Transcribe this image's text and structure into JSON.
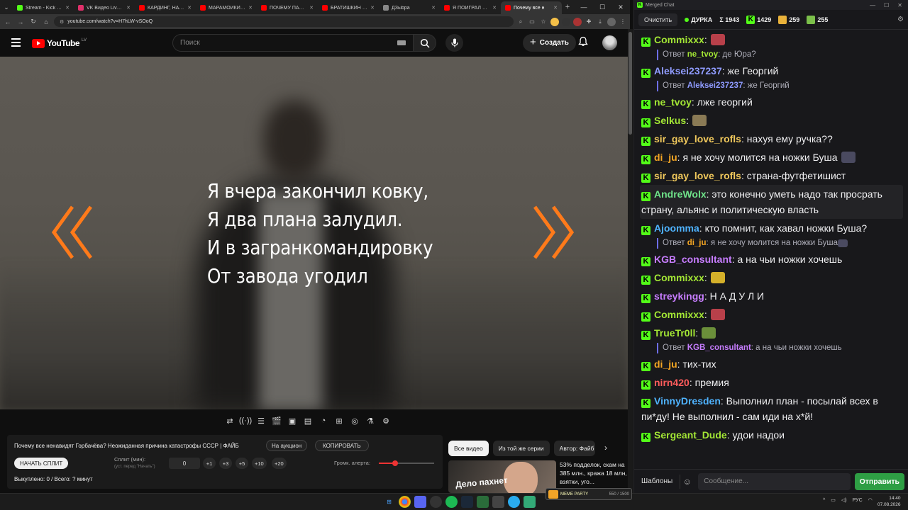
{
  "browser": {
    "tabs": [
      {
        "title": "Stream - Kick Dashbo",
        "color": "#53fc18",
        "active": false
      },
      {
        "title": "VK Видео Live — Гла",
        "color": "#e0306a",
        "active": false
      },
      {
        "title": "КАРДИНГ, НАКРУТ...",
        "color": "#ff0000",
        "active": false
      },
      {
        "title": "МАРАМОЙКИ УЧАТ",
        "color": "#ff0000",
        "active": false
      },
      {
        "title": "ПОЧЕМУ ПАПА ПР",
        "color": "#ff0000",
        "active": false
      },
      {
        "title": "БРАТИШКИН СОЦ",
        "color": "#ff0000",
        "active": false
      },
      {
        "title": "ДЗыbра",
        "color": "#888888",
        "active": false
      },
      {
        "title": "Я ПОИГРАЛ В WA...",
        "color": "#ff0000",
        "active": false
      },
      {
        "title": "Почему все н",
        "color": "#ff0000",
        "active": true
      }
    ],
    "url": "youtube.com/watch?v=H7hLW-vSOoQ",
    "newtab": "+",
    "win_min": "—",
    "win_max": "☐",
    "win_close": "✕"
  },
  "youtube": {
    "logo_text": "YouTube",
    "region": "LV",
    "search_placeholder": "Поиск",
    "create_label": "Создать",
    "create_plus": "+",
    "lyrics": [
      "Я вчера закончил ковку,",
      "Я два плана залудил.",
      "И в загранкомандировку",
      "От завода угодил"
    ],
    "accent_orange": "#ff7a1a"
  },
  "plugin_panel": {
    "video_title": "Почему все ненавидят Горбачёва? Неожиданная причина катастрофы СССР | ФАЙБ",
    "auction_btn": "На аукцион",
    "copy_btn": "КОПИРОВАТЬ",
    "start_split_btn": "НАЧАТЬ СПЛИТ",
    "split_label": "Сплит (мин):",
    "split_hint": "(уст. перед \"Начать\")",
    "split_value": "0",
    "steps": [
      "+1",
      "+3",
      "+5",
      "+10",
      "+20"
    ],
    "alert_volume_label": "Громк. алерта:",
    "alert_volume": 0.3,
    "bought_status": "Выкуплено: 0 / Всего: ? минут"
  },
  "recommendations": {
    "tabs": [
      "Все видео",
      "Из той же серии",
      "Автор: Файб"
    ],
    "first_title": "53% подделок, скам на 385 млн., кража 18 млн, взятки, уго...",
    "thumb_text": "Дело пахнет"
  },
  "chat": {
    "window_title": "Merged Chat",
    "clear_btn": "Очистить",
    "channel": "ДУРКА",
    "sum": "Σ 1943",
    "kick_count": "1429",
    "viewers2": "259",
    "viewers3": "255",
    "messages": [
      {
        "user": "Commixxx",
        "color": "#a3e635",
        "text": "",
        "emote": "#b8404a"
      },
      {
        "reply_user": "ne_tvoy",
        "reply_color": "#a3e635",
        "reply_text": ": де Юра?"
      },
      {
        "user": "Aleksei237237",
        "color": "#8f9bff",
        "text": " же Георгий"
      },
      {
        "reply_user": "Aleksei237237",
        "reply_color": "#8f9bff",
        "reply_text": ": же Георгий"
      },
      {
        "user": "ne_tvoy",
        "color": "#a3e635",
        "text": " лже георгий"
      },
      {
        "user": "Selkus",
        "color": "#a3e635",
        "text": "",
        "emote": "#8a7a55"
      },
      {
        "user": "sir_gay_love_rofls",
        "color": "#f0c85c",
        "text": " нахуя ему ручка??"
      },
      {
        "user": "di_ju",
        "color": "#f5a623",
        "text": " я не хочу молится на ножки Буша",
        "emote": "#4a4a60"
      },
      {
        "user": "sir_gay_love_rofls",
        "color": "#f0c85c",
        "text": " страна-футфетишист"
      },
      {
        "user": "AndreWolx",
        "color": "#6fe38a",
        "text": " это конечно уметь надо так просрать страну, альянс и политическую власть",
        "hl": true
      },
      {
        "user": "Ajoomma",
        "color": "#4fb3ff",
        "text": " кто помнит, как хавал ножки Буша?"
      },
      {
        "reply_user": "di_ju",
        "reply_color": "#f5a623",
        "reply_text": ": я не хочу молится на ножки Буша",
        "reply_emote": "#4a4a60"
      },
      {
        "user": "KGB_consultant",
        "color": "#c77dff",
        "text": " а на чьи ножки хочешь"
      },
      {
        "user": "Commixxx",
        "color": "#a3e635",
        "text": "",
        "emote": "#d4b02a"
      },
      {
        "user": "streykingg",
        "color": "#c77dff",
        "text": " Н А Д У Л И"
      },
      {
        "user": "Commixxx",
        "color": "#a3e635",
        "text": "",
        "emote": "#b8404a"
      },
      {
        "user": "TrueTr0ll",
        "color": "#a3e635",
        "text": "",
        "emote": "#6b8f3a"
      },
      {
        "reply_user": "KGB_consultant",
        "reply_color": "#c77dff",
        "reply_text": ": а на чьи ножки хочешь"
      },
      {
        "user": "di_ju",
        "color": "#f5a623",
        "text": " тих-тих"
      },
      {
        "user": "nirn420",
        "color": "#ff5c5c",
        "text": " премия"
      },
      {
        "user": "VinnyDresden",
        "color": "#4fb3ff",
        "text": " Выполнил план - посылай всех в пи*ду! Не выполнил - сам иди на х*й!"
      },
      {
        "user": "Sergeant_Dude",
        "color": "#a3e635",
        "text": " удои надои"
      }
    ],
    "reply_prefix": "Ответ",
    "templates_btn": "Шаблоны",
    "input_placeholder": "Сообщение...",
    "send_btn": "Отправить"
  },
  "taskbar": {
    "lang": "РУС",
    "time": "14:40",
    "date": "07.08.2026",
    "meme_label": "MEME PARTY",
    "meme_progress": "550 / 1500"
  }
}
